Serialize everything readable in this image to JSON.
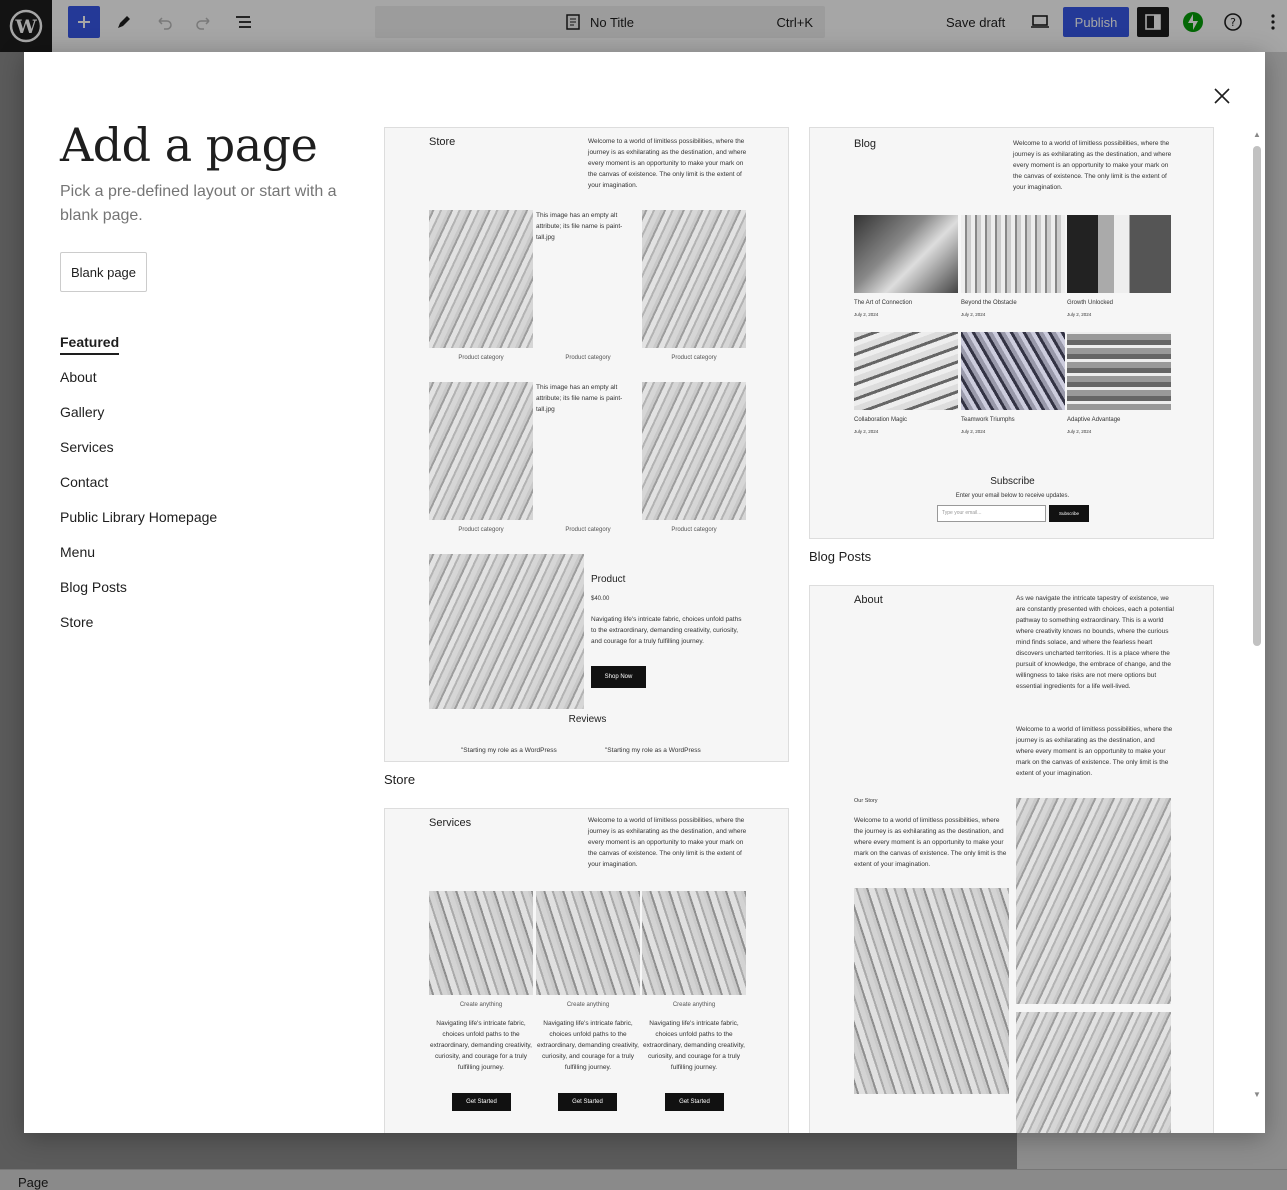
{
  "topbar": {
    "doc_title": "No Title",
    "shortcut": "Ctrl+K",
    "save_draft": "Save draft",
    "publish": "Publish"
  },
  "statusbar": {
    "label": "Page"
  },
  "modal": {
    "title": "Add a page",
    "description": "Pick a pre-defined layout or start with a blank page.",
    "blank_button": "Blank page",
    "categories": [
      "Featured",
      "About",
      "Gallery",
      "Services",
      "Contact",
      "Public Library Homepage",
      "Menu",
      "Blog Posts",
      "Store"
    ],
    "active_category": "Featured"
  },
  "store": {
    "label": "Store",
    "heading": "Store",
    "intro": "Welcome to a world of limitless possibilities, where the journey is as exhilarating as the destination, and where every moment is an opportunity to make your mark on the canvas of existence. The only limit is the extent of your imagination.",
    "broken_alt": "This image has an empty alt attribute; its file name is paint-tall.jpg",
    "product_category": "Product category",
    "product_title": "Product",
    "price": "$40.00",
    "product_desc": "Navigating life's intricate fabric, choices unfold paths to the extraordinary, demanding creativity, curiosity, and courage for a truly fulfilling journey.",
    "shop_now": "Shop Now",
    "reviews": "Reviews",
    "review_snippet": "\"Starting my role as a WordPress"
  },
  "blog": {
    "label": "Blog Posts",
    "heading": "Blog",
    "intro": "Welcome to a world of limitless possibilities, where the journey is as exhilarating as the destination, and where every moment is an opportunity to make your mark on the canvas of existence. The only limit is the extent of your imagination.",
    "posts": [
      {
        "title": "The Art of Connection",
        "date": "July 2, 2024"
      },
      {
        "title": "Beyond the Obstacle",
        "date": "July 2, 2024"
      },
      {
        "title": "Growth Unlocked",
        "date": "July 2, 2024"
      },
      {
        "title": "Collaboration Magic",
        "date": "July 2, 2024"
      },
      {
        "title": "Teamwork Triumphs",
        "date": "July 2, 2024"
      },
      {
        "title": "Adaptive Advantage",
        "date": "July 2, 2024"
      }
    ],
    "subscribe_title": "Subscribe",
    "subscribe_desc": "Enter your email below to receive updates.",
    "email_placeholder": "Type your email...",
    "subscribe_button": "Subscribe"
  },
  "services": {
    "heading": "Services",
    "intro": "Welcome to a world of limitless possibilities, where the journey is as exhilarating as the destination, and where every moment is an opportunity to make your mark on the canvas of existence. The only limit is the extent of your imagination.",
    "item_caption": "Create anything",
    "item_desc": "Navigating life's intricate fabric, choices unfold paths to the extraordinary, demanding creativity, curiosity, and courage for a truly fulfilling journey.",
    "button": "Get Started"
  },
  "about": {
    "heading": "About",
    "intro1": "As we navigate the intricate tapestry of existence, we are constantly presented with choices, each a potential pathway to something extraordinary. This is a world where creativity knows no bounds, where the curious mind finds solace, and where the fearless heart discovers uncharted territories. It is a place where the pursuit of knowledge, the embrace of change, and the willingness to take risks are not mere options but essential ingredients for a life well-lived.",
    "intro2": "Welcome to a world of limitless possibilities, where the journey is as exhilarating as the destination, and where every moment is an opportunity to make your mark on the canvas of existence. The only limit is the extent of your imagination.",
    "story_label": "Our Story",
    "story_text": "Welcome to a world of limitless possibilities, where the journey is as exhilarating as the destination, and where every moment is an opportunity to make your mark on the canvas of existence. The only limit is the extent of your imagination."
  }
}
